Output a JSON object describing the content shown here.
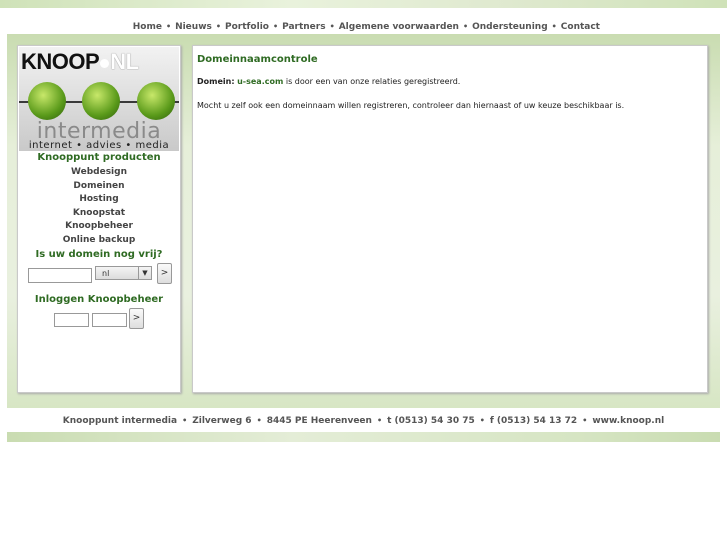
{
  "nav": {
    "items": [
      "Home",
      "Nieuws",
      "Portfolio",
      "Partners",
      "Algemene voorwaarden",
      "Ondersteuning",
      "Contact"
    ],
    "separator": "•"
  },
  "logo": {
    "brand_left": "KNOOP",
    "brand_right": "NL",
    "wordmark": "intermedia",
    "tagline": "internet • advies • media"
  },
  "sidebar": {
    "products_title": "Knooppunt producten",
    "products": [
      "Webdesign",
      "Domeinen",
      "Hosting",
      "Knoopstat",
      "Knoopbeheer",
      "Online backup"
    ],
    "domain_title": "Is uw domein nog vrij?",
    "domain_input_value": "",
    "tld_selected": "nl",
    "go_label": ">",
    "login_title": "Inloggen Knoopbeheer",
    "login_go_label": ">"
  },
  "main": {
    "title": "Domeinnaamcontrole",
    "domain_label": "Domein:",
    "domain_value": "u-sea.com",
    "domain_status": "is door een van onze relaties geregistreerd.",
    "info_text": "Mocht u zelf ook een domeinnaam willen registreren, controleer dan hiernaast of uw keuze beschikbaar is."
  },
  "footer": {
    "items": [
      "Knooppunt intermedia",
      "Zilverweg 6",
      "8445 PE Heerenveen",
      "t (0513) 54 30 75",
      "f (0513) 54 13 72",
      "www.knoop.nl"
    ],
    "separator": "•"
  },
  "colors": {
    "accent_green": "#2f6b23",
    "band_green": "#d7e6c4"
  }
}
